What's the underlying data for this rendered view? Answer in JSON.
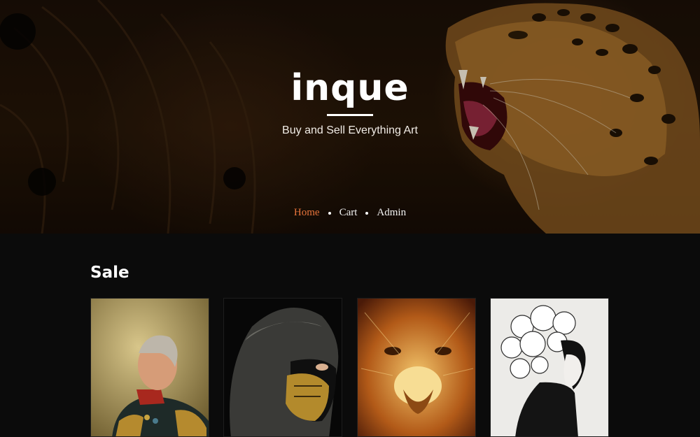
{
  "site": {
    "brand": "inque",
    "tagline": "Buy and Sell Everything Art"
  },
  "nav": {
    "items": [
      {
        "label": "Home",
        "active": true
      },
      {
        "label": "Cart",
        "active": false
      },
      {
        "label": "Admin",
        "active": false
      }
    ]
  },
  "sale": {
    "title": "Sale",
    "items": [
      {
        "art": "portrait-general-painting"
      },
      {
        "art": "masked-hooded-warrior"
      },
      {
        "art": "golden-lion-face"
      },
      {
        "art": "woman-flower-hair-sketch"
      }
    ]
  },
  "colors": {
    "accent": "#e8743b",
    "background": "#0b0b0b",
    "text": "#ffffff"
  }
}
